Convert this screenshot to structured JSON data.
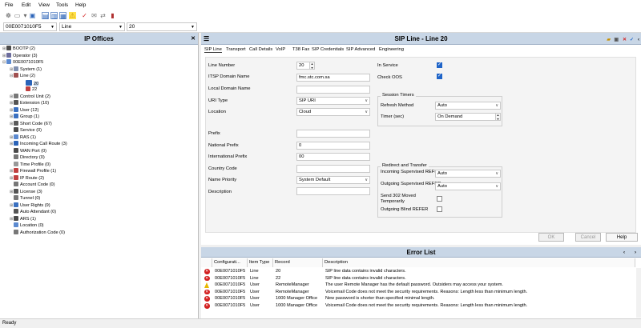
{
  "menu": {
    "file": "File",
    "edit": "Edit",
    "view": "View",
    "tools": "Tools",
    "help": "Help"
  },
  "combos": {
    "device": "00E0071010F5",
    "category": "Line",
    "item": "20"
  },
  "left_panel": {
    "title": "IP Offices",
    "tree": [
      {
        "label": "BOOTP (2)"
      },
      {
        "label": "Operator (3)"
      },
      {
        "label": "00E0071010F5"
      },
      {
        "label": "System (1)"
      },
      {
        "label": "Line (2)"
      },
      {
        "label": "20"
      },
      {
        "label": "22"
      },
      {
        "label": "Control Unit (2)"
      },
      {
        "label": "Extension (10)"
      },
      {
        "label": "User (12)"
      },
      {
        "label": "Group (1)"
      },
      {
        "label": "Short Code (67)"
      },
      {
        "label": "Service (0)"
      },
      {
        "label": "RAS (1)"
      },
      {
        "label": "Incoming Call Route (3)"
      },
      {
        "label": "WAN Port (0)"
      },
      {
        "label": "Directory (0)"
      },
      {
        "label": "Time Profile (0)"
      },
      {
        "label": "Firewall Profile (1)"
      },
      {
        "label": "IP Route (2)"
      },
      {
        "label": "Account Code (0)"
      },
      {
        "label": "License (3)"
      },
      {
        "label": "Tunnel (0)"
      },
      {
        "label": "User Rights (9)"
      },
      {
        "label": "Auto Attendant (0)"
      },
      {
        "label": "ARS (1)"
      },
      {
        "label": "Location (0)"
      },
      {
        "label": "Authorization Code (0)"
      }
    ]
  },
  "sip_panel": {
    "title": "SIP Line - Line 20",
    "tabs": [
      "SIP Line",
      "Transport",
      "Call Details",
      "VoIP",
      "T38 Fax",
      "SIP Credentials",
      "SIP Advanced",
      "Engineering"
    ],
    "fields": {
      "line_number_label": "Line Number",
      "line_number": "20",
      "itsp_domain_label": "ITSP Domain Name",
      "itsp_domain": "fmc.stc.com.sa",
      "local_domain_label": "Local Domain Name",
      "local_domain": "",
      "uri_type_label": "URI Type",
      "uri_type": "SIP URI",
      "location_label": "Location",
      "location": "Cloud",
      "prefix_label": "Prefix",
      "prefix": "",
      "national_prefix_label": "National Prefix",
      "national_prefix": "0",
      "international_prefix_label": "International Prefix",
      "international_prefix": "00",
      "country_code_label": "Country Code",
      "country_code": "",
      "name_priority_label": "Name Priority",
      "name_priority": "System Default",
      "description_label": "Description",
      "description": "",
      "in_service_label": "In Service",
      "check_oos_label": "Check OOS"
    },
    "session_timers": {
      "title": "Session Timers",
      "refresh_method_label": "Refresh Method",
      "refresh_method": "Auto",
      "timer_label": "Timer (sec)",
      "timer": "On Demand"
    },
    "redirect": {
      "title": "Redirect and Transfer",
      "incoming_label": "Incoming Supervised REFER",
      "incoming": "Auto",
      "outgoing_label": "Outgoing Supervised REFER",
      "outgoing": "Auto",
      "send302_label": "Send 302 Moved Temporarily",
      "blind_label": "Outgoing Blind REFER"
    },
    "buttons": {
      "ok": "OK",
      "cancel": "Cancel",
      "help": "Help"
    }
  },
  "error_list": {
    "title": "Error List",
    "columns": [
      "Configurati...",
      "Item Type",
      "Record",
      "Description"
    ],
    "rows": [
      {
        "severity": "error",
        "config": "00E0071010F5",
        "type": "Line",
        "record": "20",
        "desc": "SIP line data contains invalid characters."
      },
      {
        "severity": "error",
        "config": "00E0071010F5",
        "type": "Line",
        "record": "22",
        "desc": "SIP line data contains invalid characters."
      },
      {
        "severity": "warning",
        "config": "00E0071010F5",
        "type": "User",
        "record": "RemoteManager",
        "desc": "The user Remote Manager has the default password. Outsiders may access your system."
      },
      {
        "severity": "error",
        "config": "00E0071010F5",
        "type": "User",
        "record": "RemoteManager",
        "desc": "Voicemail Code does not meet the security requirements. Reasons: Length less than minimum length."
      },
      {
        "severity": "error",
        "config": "00E0071010F5",
        "type": "User",
        "record": "1000 Manager Office",
        "desc": "New password is shorter than specified minimal length."
      },
      {
        "severity": "error",
        "config": "00E0071010F5",
        "type": "User",
        "record": "1000 Manager Office",
        "desc": "Voicemail Code does not meet the security requirements. Reasons: Length less than minimum length."
      }
    ]
  },
  "status": {
    "text": "Ready"
  },
  "colors": {
    "header_blue": "#c8d6e6",
    "error_red": "#d32020",
    "warning_yellow": "#e8b800",
    "checked_blue": "#1f64c8"
  }
}
